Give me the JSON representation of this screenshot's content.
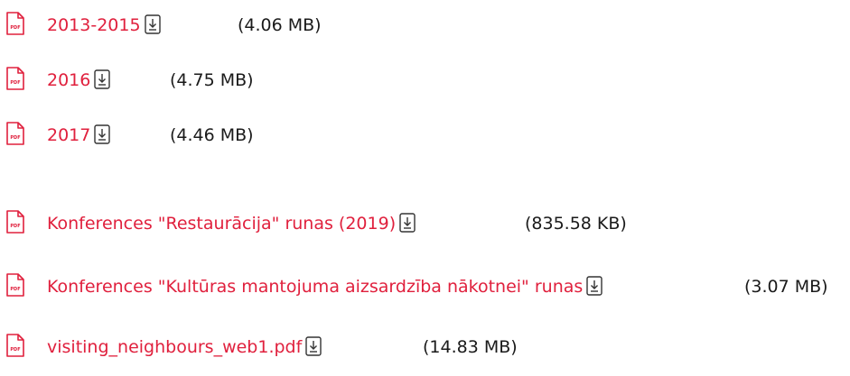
{
  "files": [
    {
      "name": "2013-2015",
      "size": "(4.06 MB)",
      "icon": "pdf-file-icon",
      "download_icon": "download-icon"
    },
    {
      "name": "2016",
      "size": "(4.75 MB)",
      "icon": "pdf-file-icon",
      "download_icon": "download-icon"
    },
    {
      "name": "2017",
      "size": "(4.46 MB)",
      "icon": "pdf-file-icon",
      "download_icon": "download-icon"
    },
    {
      "name": "Konferences \"Restaurācija\" runas (2019)",
      "size": "(835.58 KB)",
      "icon": "pdf-file-icon",
      "download_icon": "download-icon"
    },
    {
      "name": "Konferences \"Kultūras mantojuma aizsardzība nākotnei\" runas",
      "size": "(3.07 MB)",
      "icon": "pdf-file-icon",
      "download_icon": "download-icon"
    },
    {
      "name": "visiting_neighbours_web1.pdf",
      "size": "(14.83 MB)",
      "icon": "pdf-file-icon",
      "download_icon": "download-icon"
    }
  ],
  "pdf_badge": "PDF",
  "colors": {
    "link": "#e0203d",
    "icon": "#e0203d",
    "text": "#1a1a1a"
  }
}
